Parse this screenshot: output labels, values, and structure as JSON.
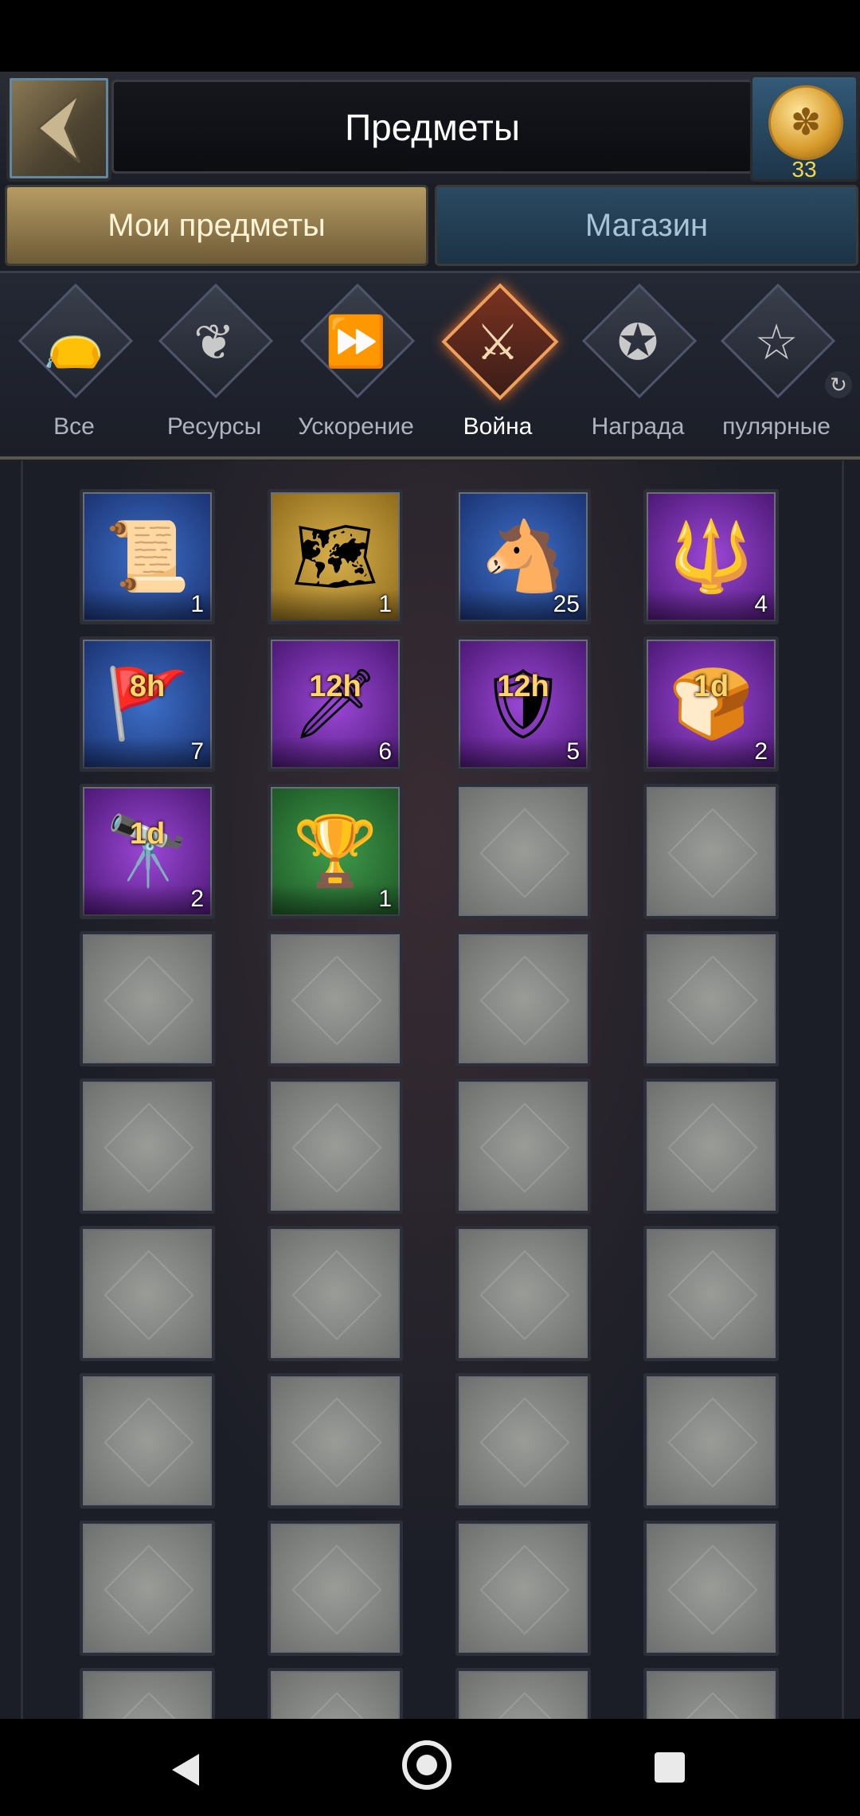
{
  "header": {
    "title": "Предметы",
    "coin_count": "33"
  },
  "tabs": [
    {
      "label": "Мои предметы",
      "active": true
    },
    {
      "label": "Магазин",
      "active": false
    }
  ],
  "categories": [
    {
      "label": "Все",
      "icon": "bag-icon",
      "active": false
    },
    {
      "label": "Ресурсы",
      "icon": "leaf-icon",
      "active": false
    },
    {
      "label": "Ускорение",
      "icon": "fast-forward-icon",
      "active": false
    },
    {
      "label": "Война",
      "icon": "crossed-swords-icon",
      "active": true
    },
    {
      "label": "Награда",
      "icon": "star-badge-icon",
      "active": false
    },
    {
      "label": "пулярные",
      "icon": "star-icon",
      "active": false
    }
  ],
  "items": [
    {
      "icon": "mystery-scroll-icon",
      "bg": "blue",
      "qty": "1"
    },
    {
      "icon": "map-scroll-icon",
      "bg": "gold",
      "qty": "1"
    },
    {
      "icon": "knight-rider-icon",
      "bg": "blue",
      "qty": "25"
    },
    {
      "icon": "spears-icon",
      "bg": "purple",
      "qty": "4"
    },
    {
      "icon": "banner-icon",
      "bg": "blue",
      "qty": "7",
      "timer": "8h"
    },
    {
      "icon": "sword-icon",
      "bg": "purple",
      "qty": "6",
      "timer": "12h"
    },
    {
      "icon": "shield-icon",
      "bg": "purple",
      "qty": "5",
      "timer": "12h"
    },
    {
      "icon": "bread-icon",
      "bg": "purple",
      "qty": "2",
      "timer": "1d"
    },
    {
      "icon": "spyglass-icon",
      "bg": "purple",
      "qty": "2",
      "timer": "1d"
    },
    {
      "icon": "trophy-card-icon",
      "bg": "green",
      "qty": "1"
    }
  ],
  "colors": {
    "accent_gold": "#b69b63",
    "active_orange": "#f0a05a",
    "timer_yellow": "#ffd56a",
    "coin_count": "#f2d84a"
  }
}
